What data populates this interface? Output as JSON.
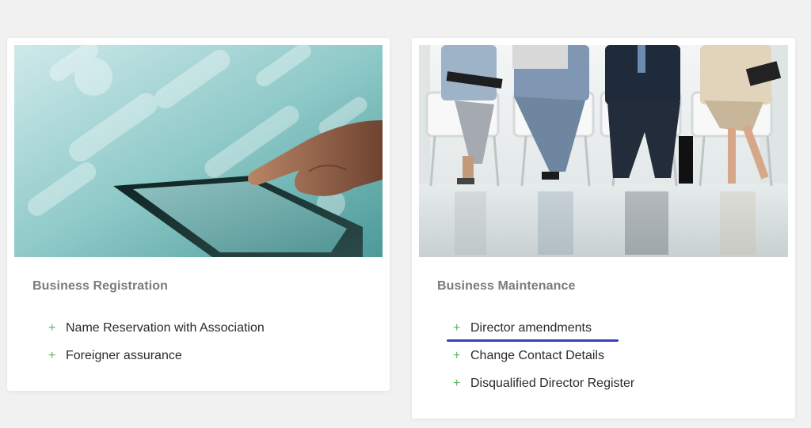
{
  "cards": [
    {
      "title": "Business Registration",
      "image": "hand-touching-tablet-photo",
      "links": [
        {
          "label": "Name Reservation with Association"
        },
        {
          "label": "Foreigner assurance"
        }
      ]
    },
    {
      "title": "Business Maintenance",
      "image": "business-people-waiting-photo",
      "links": [
        {
          "label": "Director amendments",
          "hovered": true
        },
        {
          "label": "Change Contact Details"
        },
        {
          "label": "Disqualified Director Register"
        }
      ]
    }
  ],
  "colors": {
    "background": "#f1f1f2",
    "plus_icon": "#5cb85c",
    "hover_underline": "#3b3fb8",
    "title": "#7b7b7b",
    "link": "#2b2b2b"
  },
  "icons": {
    "list_bullet": "plus-icon",
    "list_bullet_glyph": "+"
  }
}
